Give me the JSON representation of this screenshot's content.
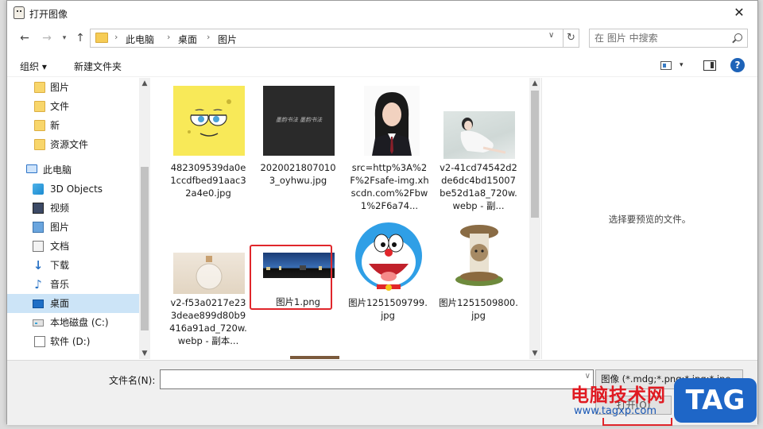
{
  "window": {
    "title": "打开图像",
    "close_glyph": "✕"
  },
  "nav": {
    "back_glyph": "←",
    "forward_glyph": "→",
    "recent_glyph": "▾",
    "up_glyph": "↑",
    "breadcrumbs": [
      "此电脑",
      "桌面",
      "图片"
    ],
    "separator": "›",
    "dropdown_glyph": "∨",
    "refresh_glyph": "↻"
  },
  "search": {
    "placeholder": "在 图片 中搜索"
  },
  "toolbar": {
    "organize_label": "组织 ▾",
    "newfolder_label": "新建文件夹",
    "view_drop": "▾",
    "help_label": "?"
  },
  "sidebar": {
    "items": [
      {
        "label": "图片",
        "icon": "folder-icon"
      },
      {
        "label": "文件",
        "icon": "folder-icon"
      },
      {
        "label": "新",
        "icon": "folder-icon"
      },
      {
        "label": "资源文件",
        "icon": "folder-icon"
      },
      {
        "label": "此电脑",
        "icon": "computer-icon"
      },
      {
        "label": "3D Objects",
        "icon": "cube-icon"
      },
      {
        "label": "视频",
        "icon": "video-icon"
      },
      {
        "label": "图片",
        "icon": "pictures-icon"
      },
      {
        "label": "文档",
        "icon": "documents-icon"
      },
      {
        "label": "下载",
        "icon": "download-icon"
      },
      {
        "label": "音乐",
        "icon": "music-icon"
      },
      {
        "label": "桌面",
        "icon": "desktop-icon"
      },
      {
        "label": "本地磁盘 (C:)",
        "icon": "disk-icon"
      },
      {
        "label": "软件 (D:)",
        "icon": "disk-icon"
      }
    ],
    "down_glyph": "♪",
    "arrow_down_glyph": "🡇"
  },
  "files": [
    {
      "name": "482309539da0e1ccdfbed91aac32a4e0.jpg",
      "thumb": "spongebob"
    },
    {
      "name": "20200218070103_oyhwu.jpg",
      "thumb": "dark-calligraphy"
    },
    {
      "name": "src=http%3A%2F%2Fsafe-img.xhscdn.com%2Fbw1%2F6a74...",
      "thumb": "id-photo"
    },
    {
      "name": "v2-41cd74542d2de6dc4bd15007be52d1a8_720w.webp - 副...",
      "thumb": "girl-photo"
    },
    {
      "name": "v2-f53a0217e233deae899d80b9416a91ad_720w.webp - 副本...",
      "thumb": "bottle"
    },
    {
      "name": "图片1.png",
      "thumb": "city-night"
    },
    {
      "name": "图片1251509799.jpg",
      "thumb": "doraemon"
    },
    {
      "name": "图片1251509800.jpg",
      "thumb": "mushroom-cat"
    }
  ],
  "calligraphy_text": "墨韵书法 墨韵书法",
  "preview": {
    "message": "选择要预览的文件。"
  },
  "bottom": {
    "filename_label": "文件名(N):",
    "filename_value": "",
    "filter_value": "图像 (*.mdg;*.png;*.jpg;*.jpe",
    "open_label": "打开(O)"
  },
  "watermark": {
    "site_name": "电脑技术网",
    "url": "www.tagxp.com",
    "tag": "TAG"
  },
  "colors": {
    "selection": "#cce4f7",
    "highlight_box": "#e0262b",
    "accent": "#1e63b8"
  }
}
